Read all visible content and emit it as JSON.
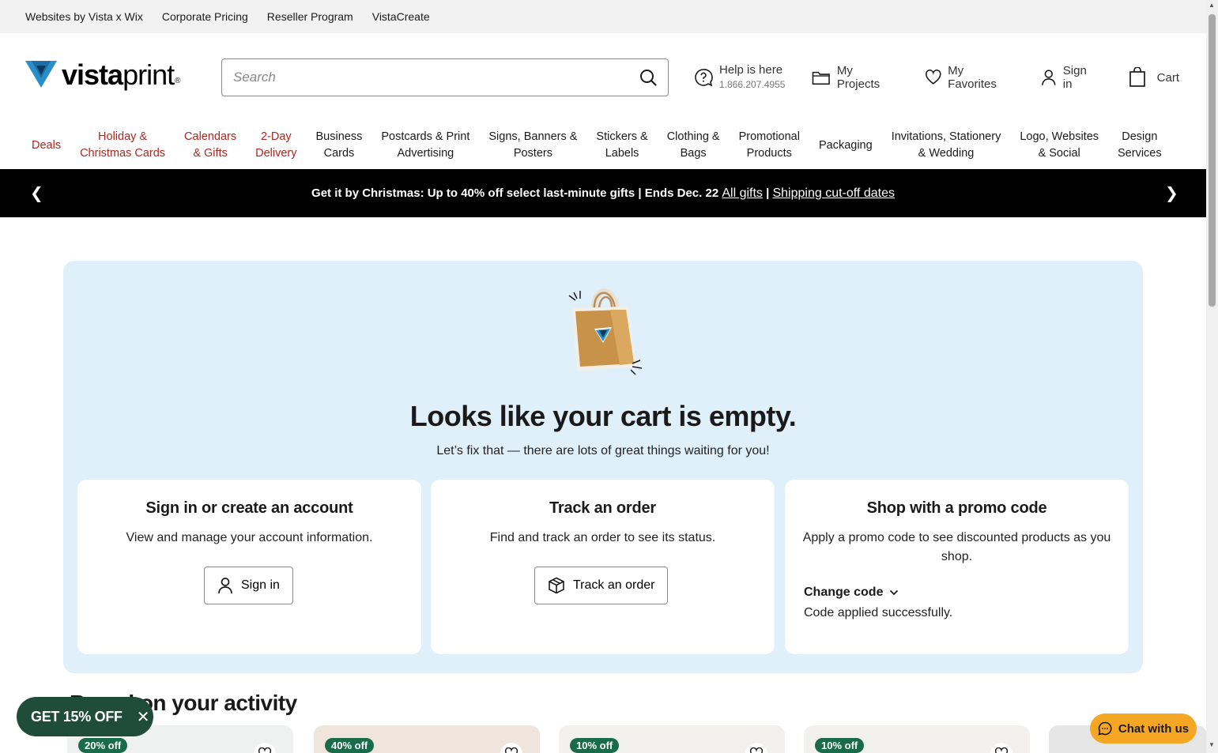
{
  "utility": {
    "links": [
      "Websites by Vista x Wix",
      "Corporate Pricing",
      "Reseller Program",
      "VistaCreate"
    ]
  },
  "header": {
    "logo_text_bold": "vista",
    "logo_text_light": "print",
    "logo_reg": "®",
    "search_placeholder": "Search",
    "help_label": "Help is here",
    "help_phone": "1.866.207.4955",
    "my_projects": "My Projects",
    "my_favorites": "My Favorites",
    "sign_in": "Sign in",
    "cart": "Cart"
  },
  "categories": [
    {
      "l1": "Deals",
      "l2": "",
      "red": true
    },
    {
      "l1": "Holiday &",
      "l2": "Christmas Cards",
      "red": true
    },
    {
      "l1": "Calendars",
      "l2": "& Gifts",
      "red": true
    },
    {
      "l1": "2-Day",
      "l2": "Delivery",
      "red": true
    },
    {
      "l1": "Business",
      "l2": "Cards",
      "red": false
    },
    {
      "l1": "Postcards & Print",
      "l2": "Advertising",
      "red": false
    },
    {
      "l1": "Signs, Banners &",
      "l2": "Posters",
      "red": false
    },
    {
      "l1": "Stickers &",
      "l2": "Labels",
      "red": false
    },
    {
      "l1": "Clothing &",
      "l2": "Bags",
      "red": false
    },
    {
      "l1": "Promotional",
      "l2": "Products",
      "red": false
    },
    {
      "l1": "Packaging",
      "l2": "",
      "red": false
    },
    {
      "l1": "Invitations, Stationery",
      "l2": "& Wedding",
      "red": false
    },
    {
      "l1": "Logo, Websites",
      "l2": "& Social",
      "red": false
    },
    {
      "l1": "Design",
      "l2": "Services",
      "red": false
    }
  ],
  "banner": {
    "text": "Get it by Christmas: Up to 40% off select last-minute gifts | Ends Dec. 22",
    "link1": "All gifts",
    "separator": "|",
    "link2": "Shipping cut-off dates"
  },
  "cart": {
    "title": "Looks like your cart is empty.",
    "subtitle": "Let’s fix that — there are lots of great things waiting for you!",
    "card_signin": {
      "title": "Sign in or create an account",
      "text": "View and manage your account information.",
      "button": "Sign in"
    },
    "card_track": {
      "title": "Track an order",
      "text": "Find and track an order to see its status.",
      "button": "Track an order"
    },
    "card_promo": {
      "title": "Shop with a promo code",
      "text": "Apply a promo code to see discounted products as you shop.",
      "change": "Change code",
      "status": "Code applied successfully."
    }
  },
  "activity": {
    "title": "Based on your activity",
    "badges": [
      "20% off",
      "40% off",
      "10% off",
      "10% off"
    ]
  },
  "widgets": {
    "discount": "GET 15% OFF",
    "chat": "Chat with us"
  },
  "colors": {
    "accent_red": "#b0261e",
    "banner_bg": "#000000",
    "panel_bg": "#dff0fa",
    "badge_green": "#1a6b4a",
    "pill_green": "#1f4d3a",
    "chat_orange": "#f5a623"
  }
}
